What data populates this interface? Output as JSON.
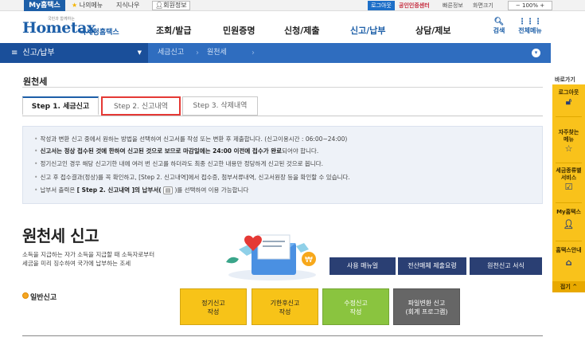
{
  "topbar": {
    "my_hometax": "My홈택스",
    "my_menu": "나의메뉴",
    "knowledge": "지식나우",
    "member_info": "회원정보",
    "logout": "로그아웃",
    "cert_center": "공인인증센터",
    "sitemap": "빠른정보",
    "font_size": "화면크기",
    "zoom": "100%"
  },
  "header": {
    "logo_tagline": "국민과 함께하는",
    "logo_main": "Hometax",
    "logo_sub": "국세청홈택스",
    "nav": [
      "조회/발급",
      "민원증명",
      "신청/제출",
      "신고/납부",
      "상담/제보"
    ],
    "search_label": "검색",
    "allmenu_label": "전체메뉴"
  },
  "location": {
    "current": "신고/납부",
    "crumb_1": "세금신고",
    "crumb_2": "원천세"
  },
  "page": {
    "title": "원천세"
  },
  "tabs": [
    {
      "label": "Step 1. 세금신고",
      "active": true
    },
    {
      "label": "Step 2. 신고내역",
      "active": false
    },
    {
      "label": "Step 3. 삭제내역",
      "active": false
    }
  ],
  "info": {
    "line_0": "작성과 변환 신고 중에서 원하는 방법을 선택하여 신고서를 작성 또는 변환 후 제출합니다. (신고이용시간 : 06:00~24:00)",
    "line_1_bold": "신고서는 정상 접수된 것에 한하여 신고된 것으로 보므로 마감일에는 24:00 이전에 접수가 완료",
    "line_1_rest": "되어야 합니다.",
    "line_2": "정기신고인 경우 해당 신고기한 내에 여러 번 신고를 하더라도 최종 신고한 내용만 정당하게 신고된 것으로 봅니다.",
    "line_3": "신고 후 접수결과(정상)를 꼭 확인하고, [Step 2. 신고내역]에서 접수증, 첨부서류내역, 신고서원장 등을 확인할 수 있습니다.",
    "line_4_pre": "납부서 출력은",
    "line_4_bold": "[ Step 2. 신고내역 ]의 납부서(",
    "line_4_post": ")를 선택하여 이용 가능합니다"
  },
  "intro": {
    "title": "원천세 신고",
    "desc_line_1": "소득을 지급하는 자가 소득을 지급할 때 소득자로부터",
    "desc_line_2": "세금을 미리 징수하여 국가에 납부하는 조세"
  },
  "buttons": {
    "manual": "사용 매뉴얼",
    "media": "전산매체 제출요령",
    "guide": "원천신고 서식"
  },
  "general": {
    "label": "일반신고",
    "regular_1": "정기신고",
    "regular_2": "작성",
    "late_1": "기한후신고",
    "late_2": "작성",
    "amend_1": "수정신고",
    "amend_2": "작성",
    "program_1": "파일변환 신고",
    "program_2": "(회계 프로그램)"
  },
  "quick": {
    "title": "바로가기",
    "items": [
      "로그아웃",
      "자주찾는 메뉴",
      "세금종류별 서비스",
      "My홈택스",
      "홈택스안내"
    ],
    "top": "접기"
  },
  "colors": {
    "brand_blue": "#1d5fa8",
    "locbar_blue": "#2f6dbf",
    "navy_button": "#2a3f73",
    "yellow": "#f7c318",
    "green": "#8ac43f"
  }
}
